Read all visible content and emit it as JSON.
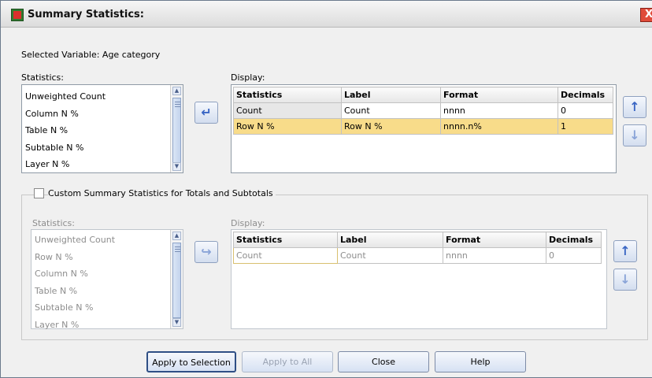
{
  "window": {
    "title": "Summary Statistics:",
    "close_glyph": "X"
  },
  "selected_variable": "Selected Variable: Age category",
  "top": {
    "statistics_label": "Statistics:",
    "statistics_items": [
      "Unweighted Count",
      "Column N %",
      "Table N %",
      "Subtable N %",
      "Layer N %"
    ],
    "display_label": "Display:",
    "columns": [
      "Statistics",
      "Label",
      "Format",
      "Decimals"
    ],
    "rows": [
      {
        "statistics": "Count",
        "label": "Count",
        "format": "nnnn",
        "decimals": "0"
      },
      {
        "statistics": "Row N %",
        "label": "Row N %",
        "format": "nnnn.n%",
        "decimals": "1"
      }
    ]
  },
  "custom": {
    "checkbox_label": "Custom Summary Statistics for Totals and Subtotals",
    "checked": false,
    "statistics_label": "Statistics:",
    "statistics_items": [
      "Unweighted Count",
      "Row N %",
      "Column N %",
      "Table N %",
      "Subtable N %",
      "Layer N %"
    ],
    "display_label": "Display:",
    "columns": [
      "Statistics",
      "Label",
      "Format",
      "Decimals"
    ],
    "rows": [
      {
        "statistics": "Count",
        "label": "Count",
        "format": "nnnn",
        "decimals": "0"
      }
    ]
  },
  "buttons": {
    "apply_selection": "Apply to Selection",
    "apply_all": "Apply to All",
    "close": "Close",
    "help": "Help"
  },
  "icons": {
    "app": "spss-table-icon",
    "add": "add-arrow-icon",
    "up": "move-up-icon",
    "down": "move-down-icon"
  },
  "colors": {
    "selected_row": "#f8dc8a",
    "arrow_blue": "#3a66c4"
  }
}
